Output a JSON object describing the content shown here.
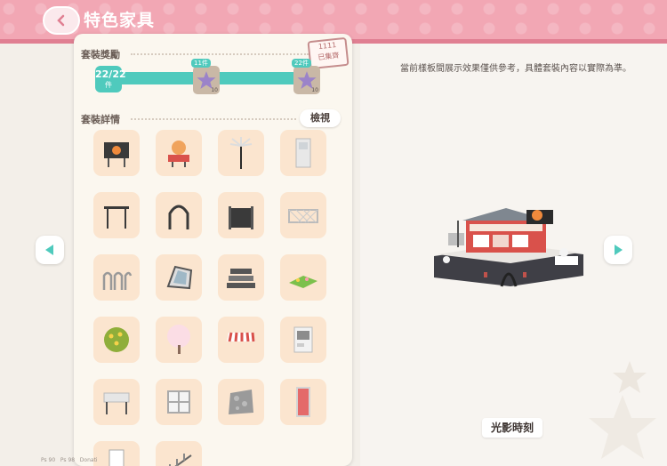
{
  "header": {
    "title": "特色家具"
  },
  "note": "當前樣板間展示效果僅供參考，具體套裝內容以實際為準。",
  "panel": {
    "reward_label": "套裝獎勵",
    "details_label": "套裝詳情",
    "view_button": "檢視",
    "stamp_text": "1111\n已集齊",
    "progress": {
      "current": "22/22",
      "unit": "件",
      "fraction": 1.0,
      "rewards": [
        {
          "tag": "11件",
          "count": "10"
        },
        {
          "tag": "22件",
          "count": "10"
        }
      ]
    }
  },
  "preview": {
    "caption": "光影時刻"
  },
  "footer_text": "        ",
  "colors": {
    "accent": "#4fcabd",
    "header": "#f2a7b4",
    "tile": "#fbe5cf"
  },
  "items": [
    "billboard-icon",
    "sign-icon",
    "palm-lamp-icon",
    "door-panel-icon",
    "pergola-icon",
    "arch-icon",
    "fence-dark-icon",
    "lattice-fence-icon",
    "bike-rack-icon",
    "skylight-icon",
    "steps-icon",
    "flowerbed-icon",
    "flower-bush-icon",
    "blossom-tree-icon",
    "awning-icon",
    "vending-icon",
    "canopy-icon",
    "window-icon",
    "stone-floor-icon",
    "red-panel-icon",
    "door-icon",
    "stair-rail-icon"
  ]
}
